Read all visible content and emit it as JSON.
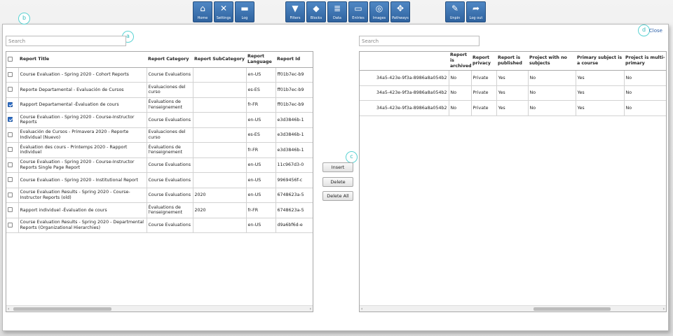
{
  "toolbar": {
    "groups": [
      [
        {
          "label": "Home",
          "icon": "home-icon"
        },
        {
          "label": "Settings",
          "icon": "tools-icon"
        },
        {
          "label": "Log",
          "icon": "chat-icon"
        }
      ],
      [
        {
          "label": "Filters",
          "icon": "filter-icon"
        },
        {
          "label": "Blocks",
          "icon": "cube-icon"
        },
        {
          "label": "Data",
          "icon": "database-icon"
        },
        {
          "label": "Entries",
          "icon": "window-icon"
        },
        {
          "label": "Images",
          "icon": "images-icon"
        },
        {
          "label": "Pathways",
          "icon": "network-icon"
        }
      ],
      [
        {
          "label": "Unpin",
          "icon": "pin-icon"
        },
        {
          "label": "Log out",
          "icon": "arrow-icon"
        }
      ]
    ]
  },
  "markers": {
    "a": "a",
    "b": "b",
    "c": "c",
    "d": "d"
  },
  "close_label": "Close",
  "left": {
    "search_placeholder": "Search",
    "columns": [
      "Report Title",
      "Report Category",
      "Report SubCategory",
      "Report Language",
      "Report Id"
    ],
    "rows": [
      {
        "checked": false,
        "title": "Course Evaluation - Spring 2020 - Cohort Reports",
        "category": "Course Evaluations",
        "subcategory": "",
        "language": "en-US",
        "id": "ff01b7ec-b9"
      },
      {
        "checked": false,
        "title": "Reporte Departamental - Evaluación de Cursos",
        "category": "Evaluaciones del curso",
        "subcategory": "",
        "language": "es-ES",
        "id": "ff01b7ec-b9"
      },
      {
        "checked": true,
        "title": "Rapport Departamental -Évaluation de cours",
        "category": "Évaluations de l'enseignement",
        "subcategory": "",
        "language": "fr-FR",
        "id": "ff01b7ec-b9"
      },
      {
        "checked": true,
        "title": "Course Evaluation - Spring 2020 - Course-Instructor Reports",
        "category": "Course Evaluations",
        "subcategory": "",
        "language": "en-US",
        "id": "e3d3846b-1"
      },
      {
        "checked": false,
        "title": "Evaluación de Cursos - Primavera 2020 - Reporte Individual (Nuevo)",
        "category": "Evaluaciones del curso",
        "subcategory": "",
        "language": "es-ES",
        "id": "e3d3846b-1"
      },
      {
        "checked": false,
        "title": "Évaluation des cours - Printemps 2020 - Rapport individuel",
        "category": "Évaluations de l'enseignement",
        "subcategory": "",
        "language": "fr-FR",
        "id": "e3d3846b-1"
      },
      {
        "checked": false,
        "title": "Course Evaluation - Spring 2020 - Course-Instructor Reports Single Page Report",
        "category": "Course Evaluations",
        "subcategory": "",
        "language": "en-US",
        "id": "11c967d3-0"
      },
      {
        "checked": false,
        "title": "Course Evaluation - Spring 2020 - Institutional Report",
        "category": "Course Evaluations",
        "subcategory": "",
        "language": "en-US",
        "id": "9969456f-c"
      },
      {
        "checked": false,
        "title": "Course Evaluation Results - Spring 2020 - Course-Instructor Reports (old)",
        "category": "Course Evaluations",
        "subcategory": "2020",
        "language": "en-US",
        "id": "6748623a-5"
      },
      {
        "checked": false,
        "title": "Rapport individuel -Évaluation de cours",
        "category": "Évaluations de l'enseignement",
        "subcategory": "2020",
        "language": "fr-FR",
        "id": "6748623a-5"
      },
      {
        "checked": false,
        "title": "Course Evaluation Results - Spring 2020 - Departmental Reports (Organizational Hierarchies)",
        "category": "Course Evaluations",
        "subcategory": "",
        "language": "en-US",
        "id": "d9a6bf6d-e"
      }
    ]
  },
  "middle": {
    "insert_label": "Insert",
    "delete_label": "Delete",
    "delete_all_label": "Delete All"
  },
  "right": {
    "search_placeholder": "Search",
    "columns": [
      "",
      "Report is archived",
      "Report privacy",
      "Report is published",
      "Project with no subjects",
      "Primary subject is a course",
      "Project is multi-primary"
    ],
    "rows": [
      [
        "34a5-423e-9f3a-8986a8a054b2",
        "No",
        "Private",
        "Yes",
        "No",
        "Yes",
        "No"
      ],
      [
        "34a5-423e-9f3a-8986a8a054b2",
        "No",
        "Private",
        "Yes",
        "No",
        "Yes",
        "No"
      ],
      [
        "34a5-423e-9f3a-8986a8a054b2",
        "No",
        "Private",
        "Yes",
        "No",
        "Yes",
        "No"
      ]
    ]
  }
}
